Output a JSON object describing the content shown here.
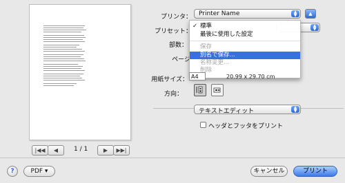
{
  "labels": {
    "printer": "プリンタ：",
    "preset": "プリセット：",
    "copies": "部数：",
    "pages": "ページ",
    "paper_size": "用紙サイズ：",
    "orientation": "方向："
  },
  "printer_popup": {
    "value": "Printer Name"
  },
  "preset_menu": {
    "items": [
      {
        "label": "標準",
        "checked": true,
        "enabled": true
      },
      {
        "label": "最後に使用した設定",
        "checked": false,
        "enabled": true
      },
      {
        "label": "保存",
        "checked": false,
        "enabled": false
      },
      {
        "label": "別名で保存...",
        "checked": false,
        "enabled": true,
        "highlighted": true
      },
      {
        "label": "名称変更...",
        "checked": false,
        "enabled": false
      },
      {
        "label": "削除",
        "checked": false,
        "enabled": false
      }
    ],
    "checkmark": "✓"
  },
  "paper_size": {
    "value": "A4",
    "dimensions": "20.99 x 29.70 cm"
  },
  "section_popup": {
    "value": "テキストエディット"
  },
  "header_footer_checkbox": {
    "label": "ヘッダとフッタをプリント",
    "checked": false
  },
  "pager": {
    "text": "1 / 1",
    "first": "|◀◀",
    "prev": "◀",
    "next": "▶",
    "last": "▶▶|"
  },
  "footer": {
    "help": "?",
    "pdf_button": "PDF ▾",
    "cancel_button": "キャンセル",
    "print_button": "プリント"
  },
  "colors": {
    "accent": "#3a6fe0",
    "default_button": "#3c7ae7"
  }
}
